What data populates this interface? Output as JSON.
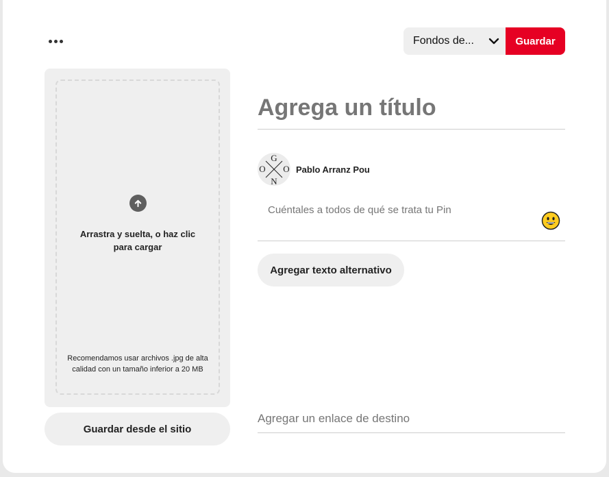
{
  "toolbar": {
    "more_icon": "ellipsis-icon",
    "board_select": {
      "value": "Fondos de...",
      "icon": "chevron-down-icon"
    },
    "save_label": "Guardar",
    "accent_color": "#e60023"
  },
  "upload": {
    "icon": "arrow-up-circle-icon",
    "instruction": "Arrastra y suelta, o haz clic para cargar",
    "hint": "Recomendamos usar archivos .jpg de alta calidad con un tamaño inferior a 20 MB",
    "save_from_site_label": "Guardar desde el sitio"
  },
  "pin": {
    "title_placeholder": "Agrega un título",
    "author": {
      "name": "Pablo Arranz Pou",
      "avatar_letters": [
        "G",
        "O",
        "O",
        "N"
      ]
    },
    "description_placeholder": "Cuéntales a todos de qué se trata tu Pin",
    "emoji_icon": "smiley-icon",
    "alt_text_label": "Agregar texto alternativo",
    "link_placeholder": "Agregar un enlace de destino"
  }
}
